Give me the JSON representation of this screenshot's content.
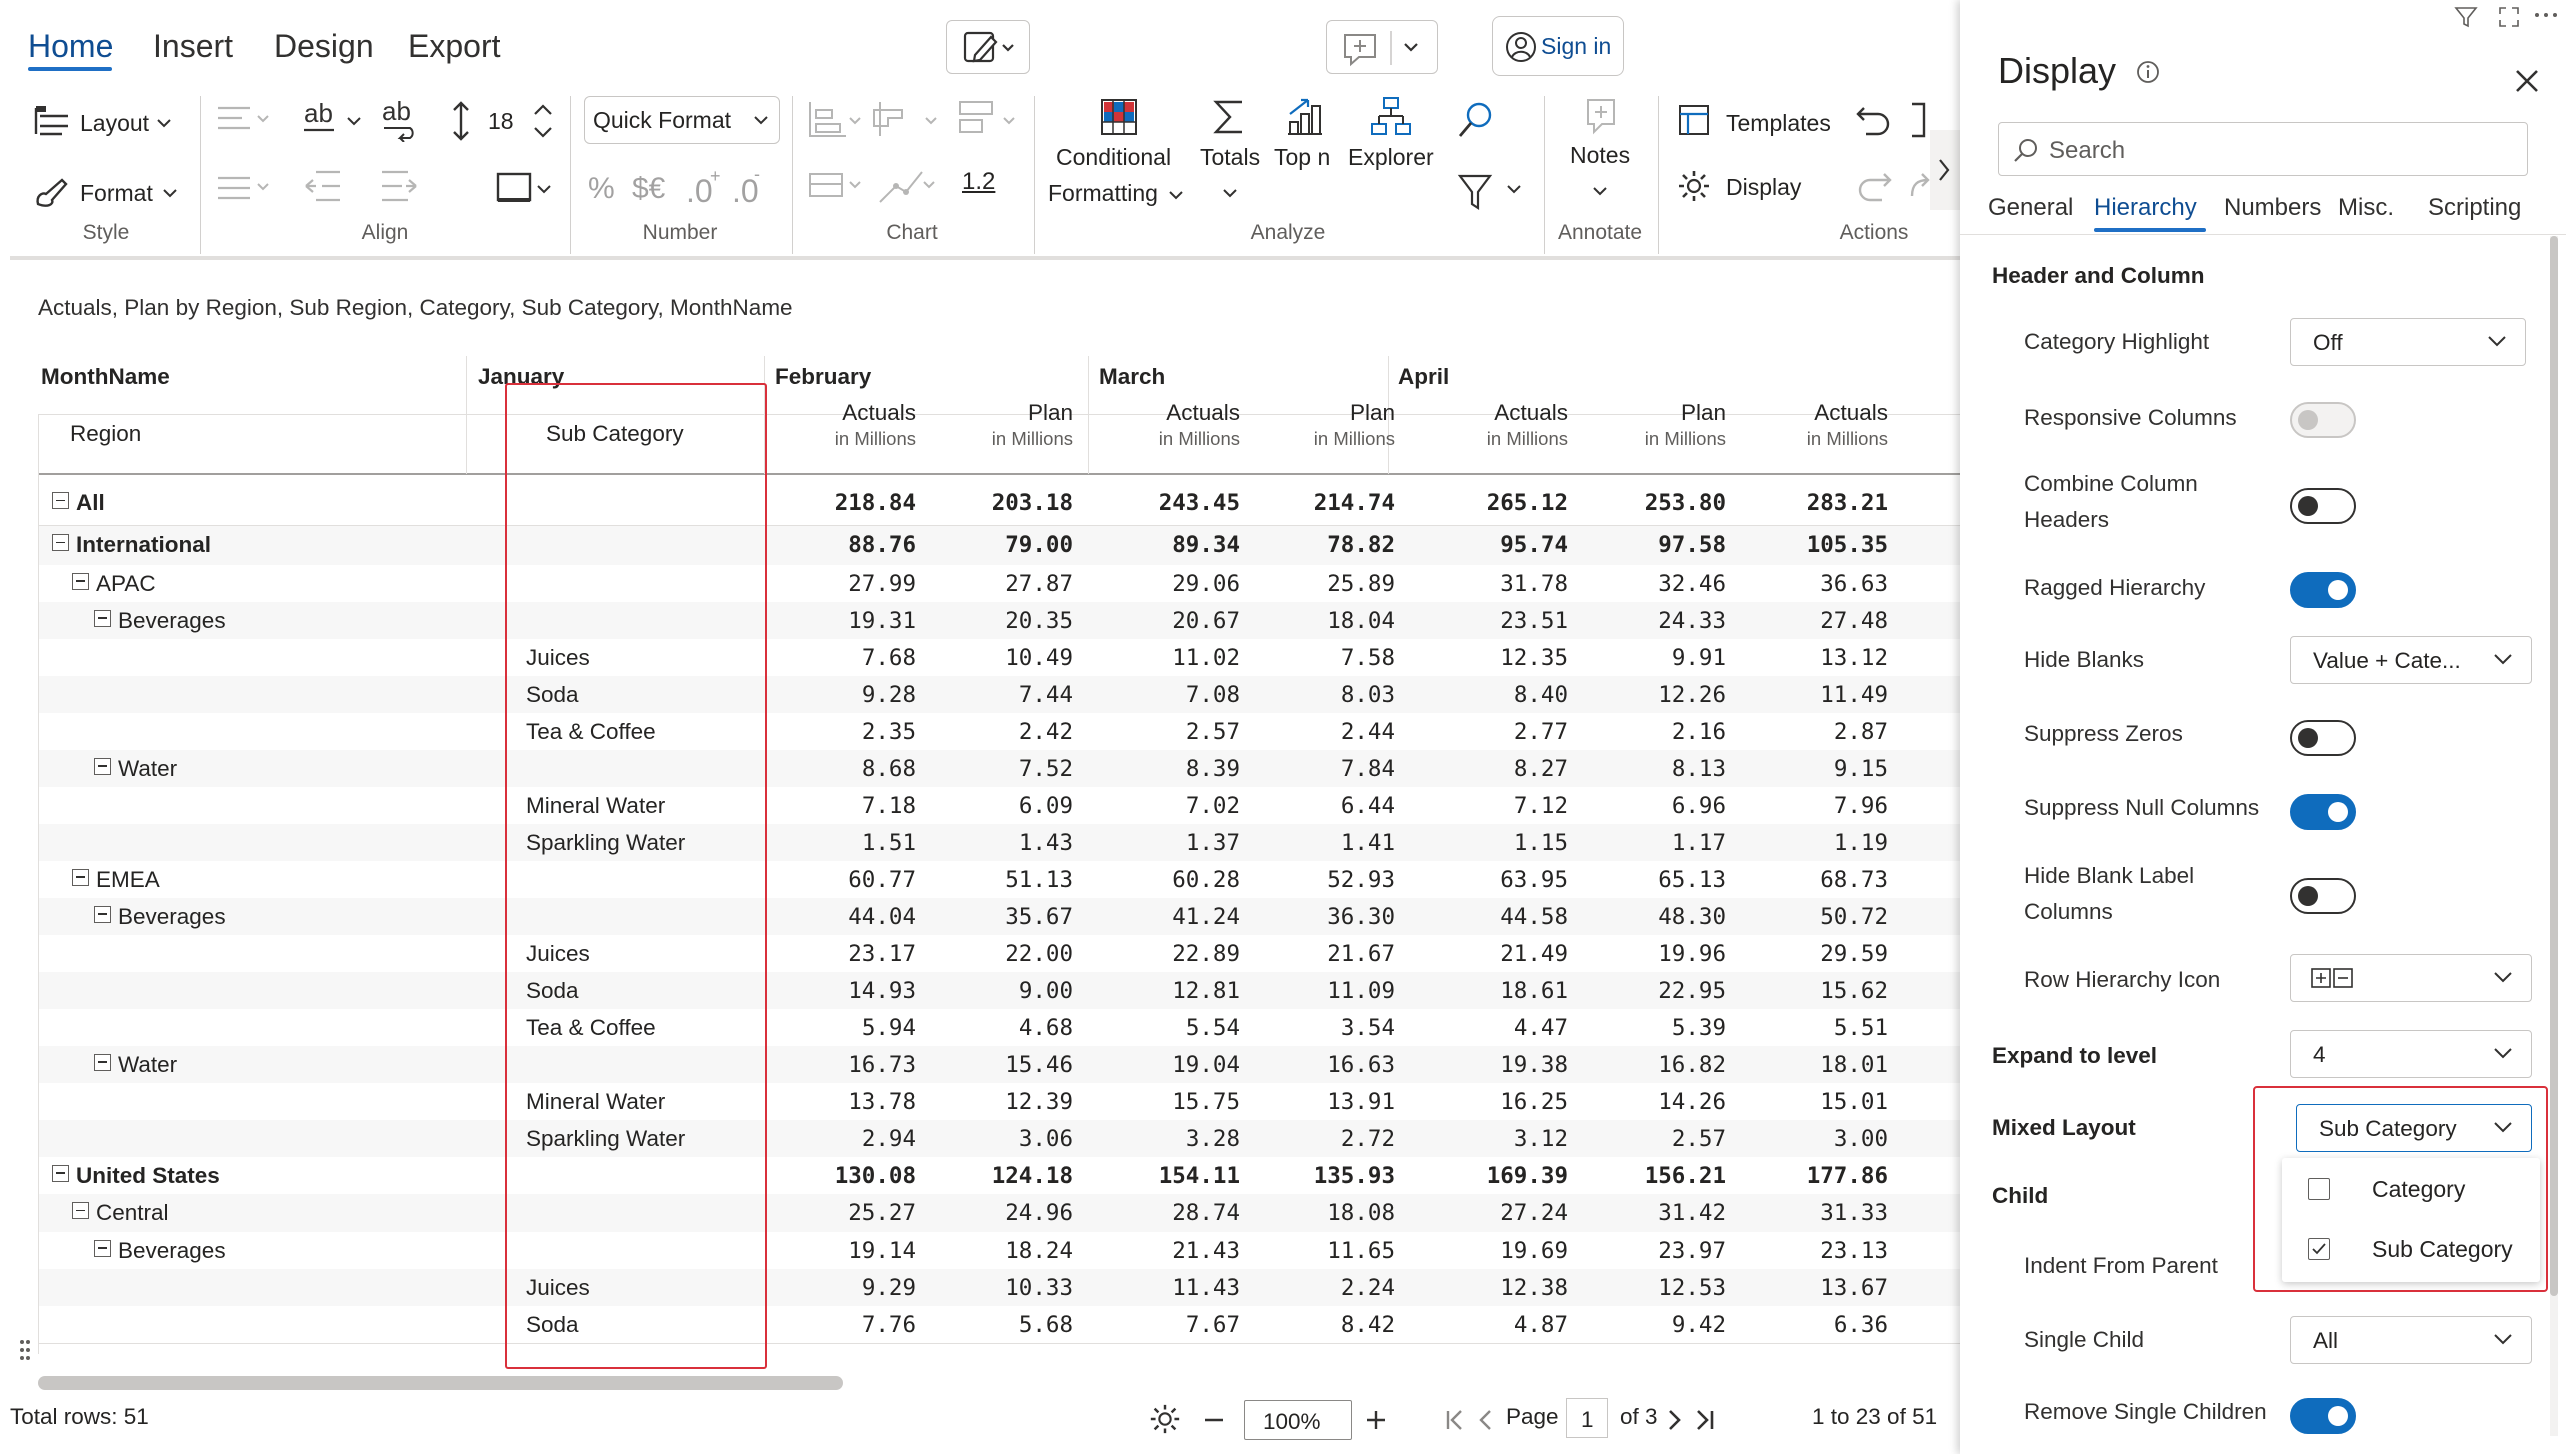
{
  "tabs": [
    {
      "label": "Home",
      "active": true
    },
    {
      "label": "Insert",
      "active": false
    },
    {
      "label": "Design",
      "active": false
    },
    {
      "label": "Export",
      "active": false
    }
  ],
  "header": {
    "sign_in": "Sign in"
  },
  "ribbon": {
    "layout": "Layout",
    "format": "Format",
    "font_size": "18",
    "quick_format": "Quick Format",
    "decimals_label": "1.2",
    "conditional_formatting_1": "Conditional",
    "conditional_formatting_2": "Formatting",
    "totals": "Totals",
    "topn": "Top n",
    "explorer": "Explorer",
    "notes": "Notes",
    "templates": "Templates",
    "display": "Display",
    "groups": {
      "style": "Style",
      "align": "Align",
      "number": "Number",
      "chart": "Chart",
      "analyze": "Analyze",
      "annotate": "Annotate",
      "actions": "Actions"
    }
  },
  "subtitle": "Actuals, Plan by Region, Sub Region, Category, Sub Category, MonthName",
  "grid": {
    "corner_top": "MonthName",
    "corner_region": "Region",
    "corner_subcategory": "Sub Category",
    "months": [
      "January",
      "February",
      "March",
      "April"
    ],
    "measures": [
      {
        "name": "Actuals",
        "unit": "in Millions"
      },
      {
        "name": "Plan",
        "unit": "in Millions"
      },
      {
        "name": "Actuals",
        "unit": "in Millions"
      },
      {
        "name": "Plan",
        "unit": "in Millions"
      },
      {
        "name": "Actuals",
        "unit": "in Millions"
      },
      {
        "name": "Plan",
        "unit": "in Millions"
      },
      {
        "name": "Actuals",
        "unit": "in Millions"
      }
    ],
    "rows": [
      {
        "label": "All",
        "level": 0,
        "bold": true,
        "toggle": true,
        "sub": "",
        "values": [
          "218.84",
          "203.18",
          "243.45",
          "214.74",
          "265.12",
          "253.80",
          "283.21"
        ]
      },
      {
        "label": "International",
        "level": 0,
        "bold": true,
        "toggle": true,
        "sub": "",
        "values": [
          "88.76",
          "79.00",
          "89.34",
          "78.82",
          "95.74",
          "97.58",
          "105.35"
        ]
      },
      {
        "label": "APAC",
        "level": 1,
        "bold": false,
        "toggle": true,
        "sub": "",
        "values": [
          "27.99",
          "27.87",
          "29.06",
          "25.89",
          "31.78",
          "32.46",
          "36.63"
        ]
      },
      {
        "label": "Beverages",
        "level": 2,
        "bold": false,
        "toggle": true,
        "sub": "",
        "values": [
          "19.31",
          "20.35",
          "20.67",
          "18.04",
          "23.51",
          "24.33",
          "27.48"
        ]
      },
      {
        "label": "",
        "level": 3,
        "bold": false,
        "toggle": false,
        "sub": "Juices",
        "values": [
          "7.68",
          "10.49",
          "11.02",
          "7.58",
          "12.35",
          "9.91",
          "13.12"
        ]
      },
      {
        "label": "",
        "level": 3,
        "bold": false,
        "toggle": false,
        "sub": "Soda",
        "values": [
          "9.28",
          "7.44",
          "7.08",
          "8.03",
          "8.40",
          "12.26",
          "11.49"
        ]
      },
      {
        "label": "",
        "level": 3,
        "bold": false,
        "toggle": false,
        "sub": "Tea & Coffee",
        "values": [
          "2.35",
          "2.42",
          "2.57",
          "2.44",
          "2.77",
          "2.16",
          "2.87"
        ]
      },
      {
        "label": "Water",
        "level": 2,
        "bold": false,
        "toggle": true,
        "sub": "",
        "values": [
          "8.68",
          "7.52",
          "8.39",
          "7.84",
          "8.27",
          "8.13",
          "9.15"
        ]
      },
      {
        "label": "",
        "level": 3,
        "bold": false,
        "toggle": false,
        "sub": "Mineral Water",
        "values": [
          "7.18",
          "6.09",
          "7.02",
          "6.44",
          "7.12",
          "6.96",
          "7.96"
        ]
      },
      {
        "label": "",
        "level": 3,
        "bold": false,
        "toggle": false,
        "sub": "Sparkling Water",
        "values": [
          "1.51",
          "1.43",
          "1.37",
          "1.41",
          "1.15",
          "1.17",
          "1.19"
        ]
      },
      {
        "label": "EMEA",
        "level": 1,
        "bold": false,
        "toggle": true,
        "sub": "",
        "values": [
          "60.77",
          "51.13",
          "60.28",
          "52.93",
          "63.95",
          "65.13",
          "68.73"
        ]
      },
      {
        "label": "Beverages",
        "level": 2,
        "bold": false,
        "toggle": true,
        "sub": "",
        "values": [
          "44.04",
          "35.67",
          "41.24",
          "36.30",
          "44.58",
          "48.30",
          "50.72"
        ]
      },
      {
        "label": "",
        "level": 3,
        "bold": false,
        "toggle": false,
        "sub": "Juices",
        "values": [
          "23.17",
          "22.00",
          "22.89",
          "21.67",
          "21.49",
          "19.96",
          "29.59"
        ]
      },
      {
        "label": "",
        "level": 3,
        "bold": false,
        "toggle": false,
        "sub": "Soda",
        "values": [
          "14.93",
          "9.00",
          "12.81",
          "11.09",
          "18.61",
          "22.95",
          "15.62"
        ]
      },
      {
        "label": "",
        "level": 3,
        "bold": false,
        "toggle": false,
        "sub": "Tea & Coffee",
        "values": [
          "5.94",
          "4.68",
          "5.54",
          "3.54",
          "4.47",
          "5.39",
          "5.51"
        ]
      },
      {
        "label": "Water",
        "level": 2,
        "bold": false,
        "toggle": true,
        "sub": "",
        "values": [
          "16.73",
          "15.46",
          "19.04",
          "16.63",
          "19.38",
          "16.82",
          "18.01"
        ]
      },
      {
        "label": "",
        "level": 3,
        "bold": false,
        "toggle": false,
        "sub": "Mineral Water",
        "values": [
          "13.78",
          "12.39",
          "15.75",
          "13.91",
          "16.25",
          "14.26",
          "15.01"
        ]
      },
      {
        "label": "",
        "level": 3,
        "bold": false,
        "toggle": false,
        "sub": "Sparkling Water",
        "values": [
          "2.94",
          "3.06",
          "3.28",
          "2.72",
          "3.12",
          "2.57",
          "3.00"
        ]
      },
      {
        "label": "United States",
        "level": 0,
        "bold": true,
        "toggle": true,
        "sub": "",
        "values": [
          "130.08",
          "124.18",
          "154.11",
          "135.93",
          "169.39",
          "156.21",
          "177.86"
        ]
      },
      {
        "label": "Central",
        "level": 1,
        "bold": false,
        "toggle": true,
        "sub": "",
        "values": [
          "25.27",
          "24.96",
          "28.74",
          "18.08",
          "27.24",
          "31.42",
          "31.33"
        ]
      },
      {
        "label": "Beverages",
        "level": 2,
        "bold": false,
        "toggle": true,
        "sub": "",
        "values": [
          "19.14",
          "18.24",
          "21.43",
          "11.65",
          "19.69",
          "23.97",
          "23.13"
        ]
      },
      {
        "label": "",
        "level": 3,
        "bold": false,
        "toggle": false,
        "sub": "Juices",
        "values": [
          "9.29",
          "10.33",
          "11.43",
          "2.24",
          "12.38",
          "12.53",
          "13.67"
        ]
      },
      {
        "label": "",
        "level": 3,
        "bold": false,
        "toggle": false,
        "sub": "Soda",
        "values": [
          "7.76",
          "5.68",
          "7.67",
          "8.42",
          "4.87",
          "9.42",
          "6.36"
        ]
      }
    ]
  },
  "statusbar": {
    "total_rows": "Total rows: 51",
    "zoom": "100%",
    "page_label": "Page",
    "page_value": "1",
    "page_of": "of 3",
    "range": "1 to 23 of 51"
  },
  "panel": {
    "title": "Display",
    "search_placeholder": "Search",
    "tabs": [
      {
        "label": "General",
        "active": false
      },
      {
        "label": "Hierarchy",
        "active": true
      },
      {
        "label": "Numbers",
        "active": false
      },
      {
        "label": "Misc.",
        "active": false
      },
      {
        "label": "Scripting",
        "active": false
      }
    ],
    "section_header_column": "Header and Column",
    "category_highlight": {
      "label": "Category Highlight",
      "value": "Off"
    },
    "responsive_columns": {
      "label": "Responsive Columns"
    },
    "combine_headers": {
      "label1": "Combine Column",
      "label2": "Headers"
    },
    "ragged_hierarchy": {
      "label": "Ragged Hierarchy"
    },
    "hide_blanks": {
      "label": "Hide Blanks",
      "value": "Value + Cate..."
    },
    "suppress_zeros": {
      "label": "Suppress Zeros"
    },
    "suppress_null": {
      "label": "Suppress Null Columns"
    },
    "hide_blank_label": {
      "label1": "Hide Blank Label",
      "label2": "Columns"
    },
    "row_hierarchy_icon": {
      "label": "Row Hierarchy Icon"
    },
    "expand_level": {
      "label": "Expand to level",
      "value": "4"
    },
    "mixed_layout": {
      "label": "Mixed Layout",
      "value": "Sub Category",
      "options": [
        {
          "label": "Category",
          "checked": false
        },
        {
          "label": "Sub Category",
          "checked": true
        }
      ]
    },
    "child": {
      "label": "Child"
    },
    "indent_from_parent": {
      "label": "Indent From Parent"
    },
    "single_child": {
      "label": "Single Child",
      "value": "All"
    },
    "remove_single_children": {
      "label": "Remove Single Children"
    }
  },
  "colors": {
    "accent": "#0f6cbd",
    "highlight_box": "#d9303b",
    "tab_active": "#0f4d92"
  }
}
